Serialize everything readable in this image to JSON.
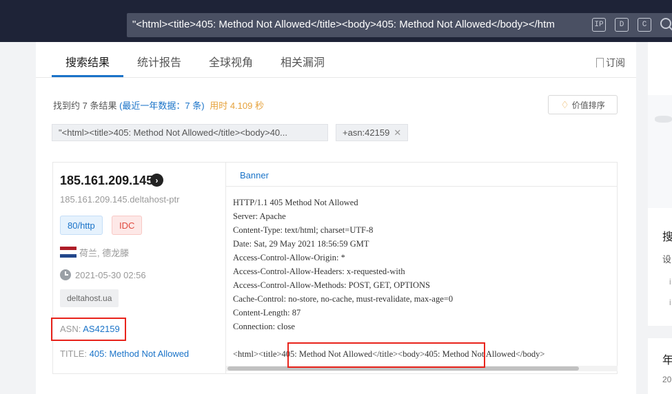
{
  "search": {
    "query": "\"<html><title>405: Method Not Allowed</title><body>405: Method Not Allowed</body></htm",
    "icons": [
      "ip-search-icon",
      "domain-search-icon",
      "cert-search-icon",
      "search-icon"
    ],
    "icon_labels": [
      "IP",
      "D",
      "C"
    ]
  },
  "tabs": [
    {
      "label": "搜索结果",
      "active": true
    },
    {
      "label": "统计报告",
      "active": false
    },
    {
      "label": "全球视角",
      "active": false
    },
    {
      "label": "相关漏洞",
      "active": false
    }
  ],
  "subscribe_label": "订阅",
  "results": {
    "prefix": "找到约 7 条结果 ",
    "recent": "(最近一年数据：7 条)",
    "time": "用时 4.109 秒"
  },
  "sort_button": "价值排序",
  "filters": [
    {
      "label": "\"<html><title>405: Method Not Allowed</title><body>40..."
    },
    {
      "label": "+asn:42159",
      "close": "✕"
    }
  ],
  "card": {
    "ip": "185.161.209.145",
    "hostname": "185.161.209.145.deltahost-ptr",
    "port_tag": "80/http",
    "idc_tag": "IDC",
    "location": "荷兰, 德龙滕",
    "date": "2021-05-30 02:56",
    "domain": "deltahost.ua",
    "asn_label": "ASN: ",
    "asn_value": "AS42159",
    "title_label": "TITLE: ",
    "title_value": "405: Method Not Allowed",
    "banner_tab": "Banner",
    "banner_text": "HTTP/1.1 405 Method Not Allowed\nServer: Apache\nContent-Type: text/html; charset=UTF-8\nDate: Sat, 29 May 2021 18:56:59 GMT\nAccess-Control-Allow-Origin: *\nAccess-Control-Allow-Headers: x-requested-with\nAccess-Control-Allow-Methods: POST, GET, OPTIONS\nCache-Control: no-store, no-cache, must-revalidate, max-age=0\nContent-Length: 87\nConnection: close\n\n<html><title>405: Method Not Allowed</title><body>405: Method Not Allowed</body>"
  },
  "sidebar": {
    "heading1": "搜",
    "item1": "设",
    "item2": "i",
    "item3": "i",
    "heading2": "年",
    "item4": "20"
  },
  "colors": {
    "topbar": "#1e2337",
    "accent": "#1a73c8",
    "highlight_box": "#e8231b",
    "time_text": "#e6a23c"
  }
}
